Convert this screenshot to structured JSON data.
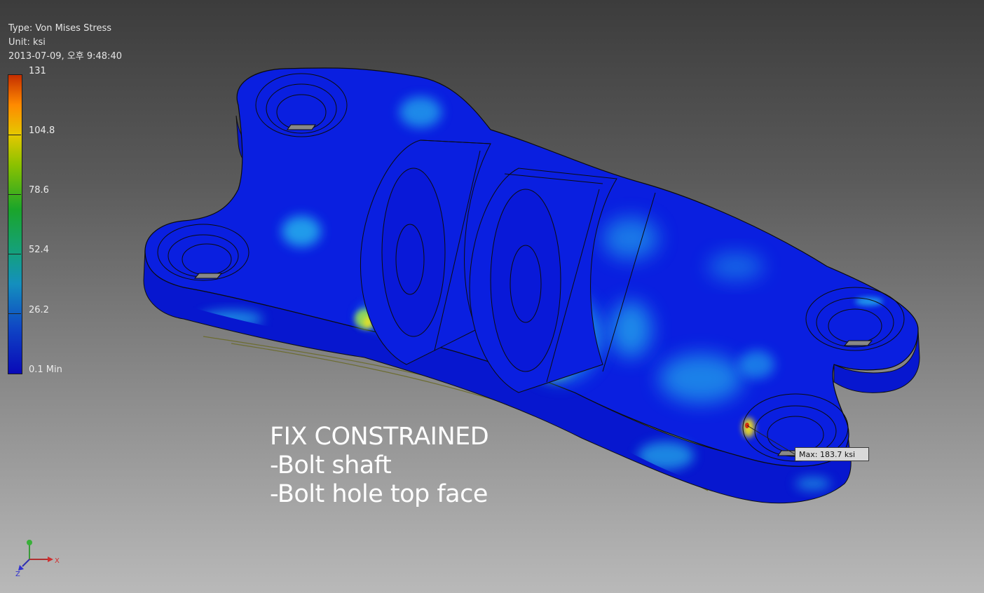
{
  "viewport": {
    "result_type": "Type: Von Mises Stress",
    "unit": "Unit: ksi",
    "timestamp": "2013-07-09, 오후 9:48:40"
  },
  "legend": {
    "labels": [
      "131",
      "104.8",
      "78.6",
      "52.4",
      "26.2",
      "0.1 Min"
    ],
    "colors": {
      "high": "#c42e00",
      "mid_high": "#e5c800",
      "mid": "#1aa52a",
      "mid_low": "#148fbe",
      "low": "#0909b8"
    }
  },
  "model": {
    "name": "Bracket part with stress contour",
    "base_color": "#0a1fe0",
    "hotspot_colors": [
      "#2ad0f0",
      "#6fe070",
      "#f0e020",
      "#d03010"
    ]
  },
  "annotation": {
    "line1": "FIX CONSTRAINED",
    "line2": "-Bolt shaft",
    "line3": "-Bolt hole top face"
  },
  "probe": {
    "label": "Max: 183.7 ksi"
  },
  "triad": {
    "x_label": "X",
    "z_label": "Z",
    "icon": "view-triad-icon"
  }
}
